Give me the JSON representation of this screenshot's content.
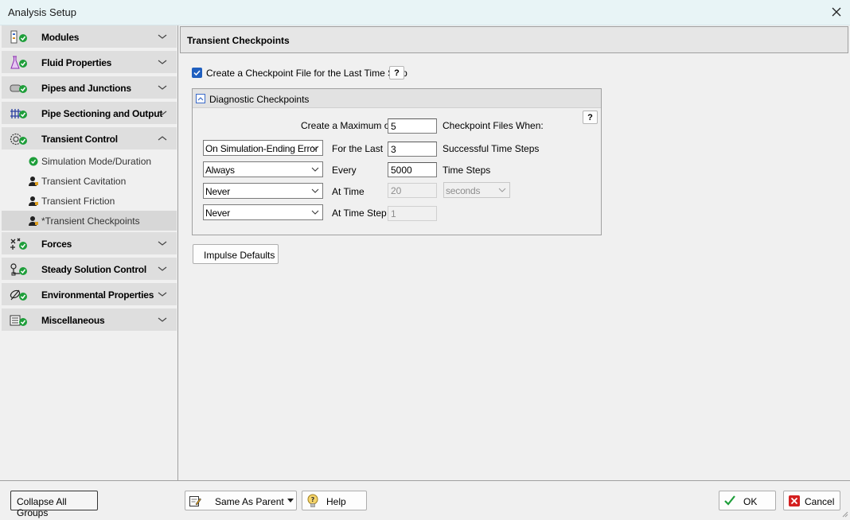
{
  "window": {
    "title": "Analysis Setup"
  },
  "sidebar": {
    "groups": [
      {
        "label": "Modules",
        "icon": "modules-icon"
      },
      {
        "label": "Fluid Properties",
        "icon": "flask-icon"
      },
      {
        "label": "Pipes and Junctions",
        "icon": "pipe-icon"
      },
      {
        "label": "Pipe Sectioning and Output",
        "icon": "pipe-sectioning-icon"
      },
      {
        "label": "Transient Control",
        "icon": "transient-control-icon",
        "expanded": true
      },
      {
        "label": "Forces",
        "icon": "forces-icon"
      },
      {
        "label": "Steady Solution Control",
        "icon": "steady-solution-icon"
      },
      {
        "label": "Environmental Properties",
        "icon": "environment-icon"
      },
      {
        "label": "Miscellaneous",
        "icon": "miscellaneous-icon"
      }
    ],
    "subitems": [
      {
        "label": "Simulation Mode/Duration",
        "status": "ok"
      },
      {
        "label": "Transient Cavitation",
        "status": "user"
      },
      {
        "label": "Transient Friction",
        "status": "user"
      },
      {
        "label": "*Transient Checkpoints",
        "status": "user",
        "selected": true
      }
    ]
  },
  "panel": {
    "title": "Transient Checkpoints",
    "last_step_checkbox": {
      "label": "Create a Checkpoint File for the Last Time Step",
      "checked": true
    },
    "help_label": "?",
    "diagnostic": {
      "title": "Diagnostic Checkpoints",
      "max_label": "Create a Maximum of",
      "max_value": "5",
      "when_label": "Checkpoint Files When:",
      "rows": [
        {
          "select": "On Simulation-Ending Error",
          "label": "For the Last",
          "value": "3",
          "unit": "Successful Time Steps",
          "disabled": false
        },
        {
          "select": "Always",
          "label": "Every",
          "value": "5000",
          "unit": "Time Steps",
          "disabled": false
        },
        {
          "select": "Never",
          "label": "At Time",
          "value": "20",
          "unit_select": "seconds",
          "disabled": true
        },
        {
          "select": "Never",
          "label": "At Time Step",
          "value": "1",
          "disabled": true
        }
      ]
    },
    "impulse_defaults_label": "Impulse Defaults"
  },
  "footer": {
    "collapse_label": "Collapse All Groups",
    "same_as_parent_label": "Same As Parent",
    "help_label": "Help",
    "ok_label": "OK",
    "cancel_label": "Cancel"
  },
  "colors": {
    "accent": "#1f5fbf",
    "ok_green": "#1e9e3a",
    "cancel_red": "#d42020"
  }
}
